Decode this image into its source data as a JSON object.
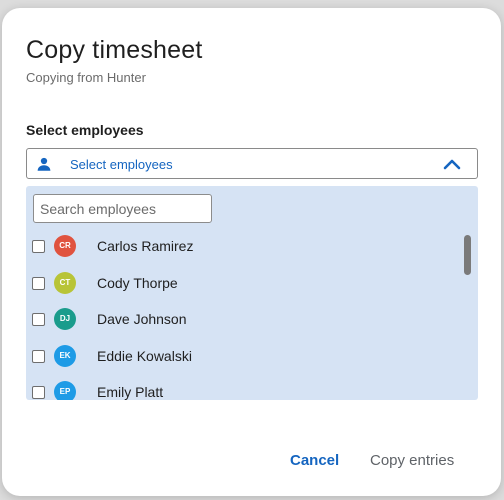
{
  "dialog": {
    "title": "Copy timesheet",
    "subtitle": "Copying from Hunter"
  },
  "employee_select": {
    "label": "Select employees",
    "placeholder": "Select employees",
    "icon": "person-icon",
    "expanded": true,
    "accent_color": "#1565c0"
  },
  "dropdown": {
    "search_placeholder": "Search employees",
    "background_color": "#d6e3f4",
    "employees": [
      {
        "initials": "CR",
        "name": "Carlos Ramirez",
        "color": "#e0533f",
        "checked": false
      },
      {
        "initials": "CT",
        "name": "Cody Thorpe",
        "color": "#b8c437",
        "checked": false
      },
      {
        "initials": "DJ",
        "name": "Dave Johnson",
        "color": "#1a9c8c",
        "checked": false
      },
      {
        "initials": "EK",
        "name": "Eddie Kowalski",
        "color": "#1e9be6",
        "checked": false
      },
      {
        "initials": "EP",
        "name": "Emily Platt",
        "color": "#1e9be6",
        "checked": false
      }
    ]
  },
  "actions": {
    "cancel_label": "Cancel",
    "copy_label": "Copy entries"
  }
}
